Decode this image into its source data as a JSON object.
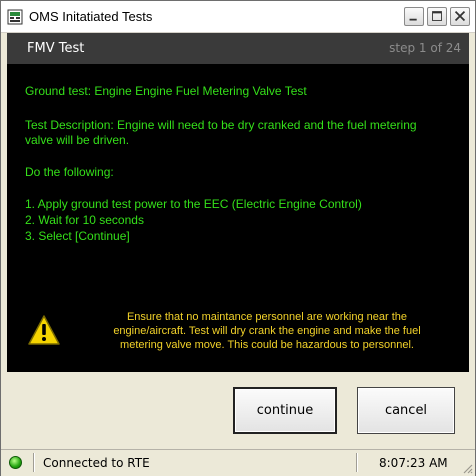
{
  "window": {
    "title": "OMS Initatiated Tests",
    "icon": "app-icon",
    "controls": {
      "minimize": "minimize-icon",
      "maximize": "maximize-icon",
      "close": "close-icon"
    }
  },
  "step": {
    "title": "FMV Test",
    "counter": "step 1 of 24"
  },
  "content": {
    "ground_test": "Ground test: Engine Engine Fuel Metering Valve Test",
    "description_line1": "Test Description: Engine will need to be dry cranked and the fuel metering",
    "description_line2": "valve will be driven.",
    "instructions_heading": "Do the following:",
    "instructions": [
      "1. Apply ground test power to the EEC (Electric Engine Control)",
      "2. Wait for 10 seconds",
      "3. Select [Continue]"
    ],
    "warning_lines": [
      "Ensure that no maintance personnel are working near the",
      "engine/aircraft. Test will dry crank the engine and make the fuel",
      "metering valve move. This could be hazardous to personnel."
    ],
    "text_color": "#35e01a",
    "warning_color": "#f2d22a"
  },
  "buttons": {
    "continue_label": "continue",
    "cancel_label": "cancel"
  },
  "status": {
    "connection_text": "Connected to RTE",
    "connection_indicator_color": "#22a410",
    "time": "8:07:23 AM"
  }
}
